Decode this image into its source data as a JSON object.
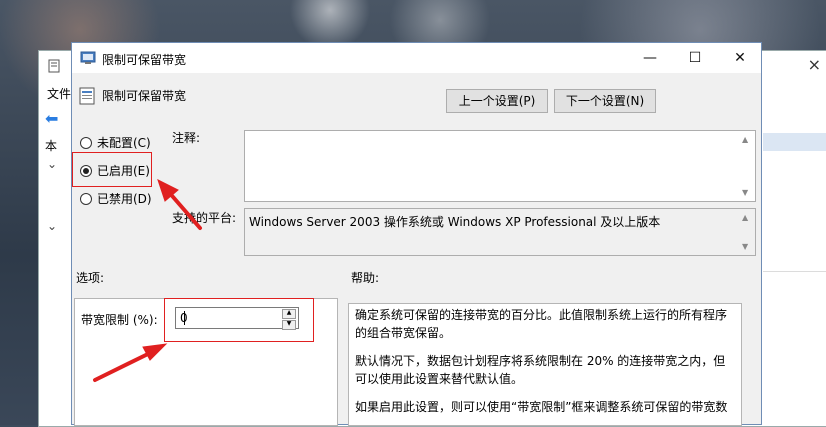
{
  "background_window": {
    "menu_label": "文件",
    "tree_item_label": "本",
    "close_symbol": "×"
  },
  "dialog": {
    "title": "限制可保留带宽",
    "header_title": "限制可保留带宽",
    "prev_button": "上一个设置(P)",
    "next_button": "下一个设置(N)",
    "minimize_symbol": "—",
    "maximize_symbol": "☐",
    "close_symbol": "✕",
    "radios": [
      {
        "label": "未配置(C)",
        "selected": false
      },
      {
        "label": "已启用(E)",
        "selected": true
      },
      {
        "label": "已禁用(D)",
        "selected": false
      }
    ],
    "comment_label": "注释:",
    "comment_value": "",
    "platform_label": "支持的平台:",
    "platform_value": "Windows Server 2003 操作系统或 Windows XP Professional 及以上版本",
    "options_label": "选项:",
    "help_label": "帮助:",
    "bandwidth_label": "带宽限制 (%):",
    "bandwidth_value": "0",
    "help_paragraphs": [
      "确定系统可保留的连接带宽的百分比。此值限制系统上运行的所有程序的组合带宽保留。",
      "默认情况下，数据包计划程序将系统限制在 20% 的连接带宽之内，但可以使用此设置来替代默认值。",
      "如果启用此设置，则可以使用“带宽限制”框来调整系统可保留的带宽数"
    ]
  },
  "colors": {
    "annotation_red": "#e02020",
    "dialog_border": "#6f8db5"
  }
}
